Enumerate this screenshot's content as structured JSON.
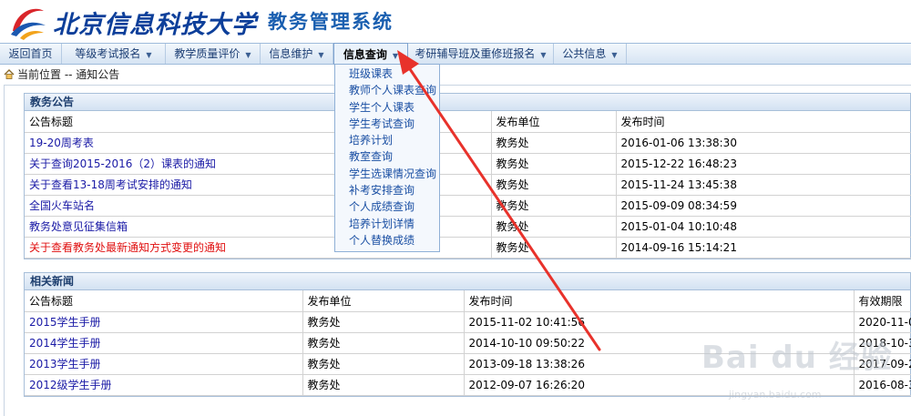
{
  "header": {
    "school_name": "北京信息科技大学",
    "system_name": "教务管理系统"
  },
  "nav": [
    {
      "label": "返回首页",
      "has_caret": false
    },
    {
      "label": "等级考试报名",
      "has_caret": true
    },
    {
      "label": "教学质量评价",
      "has_caret": true
    },
    {
      "label": "信息维护",
      "has_caret": true
    },
    {
      "label": "信息查询",
      "has_caret": true,
      "active": true
    },
    {
      "label": "考研辅导班及重修班报名",
      "has_caret": true
    },
    {
      "label": "公共信息",
      "has_caret": true
    }
  ],
  "location": {
    "text": "当前位置 -- 通知公告"
  },
  "dropdown": {
    "items": [
      "班级课表",
      "教师个人课表查询",
      "学生个人课表",
      "学生考试查询",
      "培养计划",
      "教室查询",
      "学生选课情况查询",
      "补考安排查询",
      "个人成绩查询",
      "培养计划详情",
      "个人替换成绩"
    ]
  },
  "announcements": {
    "title": "教务公告",
    "headers": [
      "公告标题",
      "发布单位",
      "发布时间"
    ],
    "rows": [
      {
        "title": "19-20周考表",
        "unit": "教务处",
        "time": "2016-01-06 13:38:30",
        "red": false
      },
      {
        "title": "关于查询2015-2016（2）课表的通知",
        "unit": "教务处",
        "time": "2015-12-22 16:48:23",
        "red": false
      },
      {
        "title": "关于查看13-18周考试安排的通知",
        "unit": "教务处",
        "time": "2015-11-24 13:45:38",
        "red": false
      },
      {
        "title": "全国火车站名",
        "unit": "教务处",
        "time": "2015-09-09 08:34:59",
        "red": false
      },
      {
        "title": "教务处意见征集信箱",
        "unit": "教务处",
        "time": "2015-01-04 10:10:48",
        "red": false
      },
      {
        "title": "关于查看教务处最新通知方式变更的通知",
        "unit": "教务处",
        "time": "2014-09-16 15:14:21",
        "red": true
      }
    ]
  },
  "news": {
    "title": "相关新闻",
    "headers": [
      "公告标题",
      "发布单位",
      "发布时间",
      "有效期限"
    ],
    "rows": [
      {
        "title": "2015学生手册",
        "unit": "教务处",
        "time": "2015-11-02 10:41:56",
        "expiry": "2020-11-0"
      },
      {
        "title": "2014学生手册",
        "unit": "教务处",
        "time": "2014-10-10 09:50:22",
        "expiry": "2018-10-3"
      },
      {
        "title": "2013学生手册",
        "unit": "教务处",
        "time": "2013-09-18 13:38:26",
        "expiry": "2017-09-2"
      },
      {
        "title": "2012级学生手册",
        "unit": "教务处",
        "time": "2012-09-07 16:26:20",
        "expiry": "2016-08-3"
      }
    ]
  },
  "watermark": {
    "main": "Bai du 经验",
    "sub": "jingyan.baidu.com"
  },
  "colors": {
    "accent": "#1a5fb0",
    "link": "#1a1aa6",
    "highlight_red": "#e01010",
    "arrow": "#e8322b"
  }
}
